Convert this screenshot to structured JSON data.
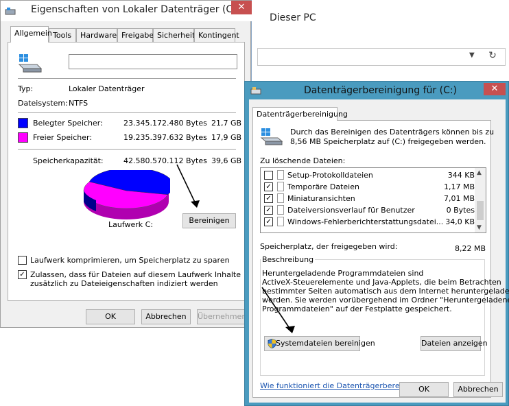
{
  "explorer": {
    "title": "Dieser PC",
    "dropdown_icon": "chevron-down-icon",
    "refresh_icon": "refresh-icon"
  },
  "properties": {
    "title": "Eigenschaften von Lokaler Datenträger (C:)",
    "close_icon": "close-icon",
    "tabs": [
      "Allgemein",
      "Tools",
      "Hardware",
      "Freigabe",
      "Sicherheit",
      "Kontingent"
    ],
    "name_value": "",
    "type_label": "Typ:",
    "type_value": "Lokaler Datenträger",
    "fs_label": "Dateisystem:",
    "fs_value": "NTFS",
    "used_label": "Belegter Speicher:",
    "used_bytes": "23.345.172.480 Bytes",
    "used_gb": "21,7 GB",
    "free_label": "Freier Speicher:",
    "free_bytes": "19.235.397.632 Bytes",
    "free_gb": "17,9 GB",
    "cap_label": "Speicherkapazität:",
    "cap_bytes": "42.580.570.112 Bytes",
    "cap_gb": "39,6 GB",
    "drive_label": "Laufwerk C:",
    "cleanup_button": "Bereinigen",
    "compress_label": "Laufwerk komprimieren, um Speicherplatz zu sparen",
    "compress_checked": false,
    "index_label_1": "Zulassen, dass für Dateien auf diesem Laufwerk Inhalte",
    "index_label_2": "zusätzlich zu Dateieigenschaften indiziert werden",
    "index_checked": true,
    "ok": "OK",
    "cancel": "Abbrechen",
    "apply": "Übernehmen",
    "used_color": "#0000ff",
    "free_color": "#ff00ff",
    "used_fraction": 0.548,
    "free_fraction": 0.452
  },
  "cleanup": {
    "title": "Datenträgerbereinigung für  (C:)",
    "close_icon": "close-icon",
    "tab": "Datenträgerbereinigung",
    "intro_1": "Durch das Bereinigen des Datenträgers können bis zu",
    "intro_2": "8,56 MB Speicherplatz auf  (C:) freigegeben werden.",
    "list_label": "Zu löschende Dateien:",
    "items": [
      {
        "label": "Setup-Protokolldateien",
        "size": "344 KB",
        "checked": false
      },
      {
        "label": "Temporäre Dateien",
        "size": "1,17 MB",
        "checked": true
      },
      {
        "label": "Miniaturansichten",
        "size": "7,01 MB",
        "checked": true
      },
      {
        "label": "Dateiversionsverlauf für Benutzer",
        "size": "0 Bytes",
        "checked": true
      },
      {
        "label": "Windows-Fehlerberichterstattungsdatei...",
        "size": "34,0 KB",
        "checked": true
      }
    ],
    "freed_label": "Speicherplatz, der freigegeben wird:",
    "freed_value": "8,22 MB",
    "desc_title": "Beschreibung",
    "desc_1": "Heruntergeladende Programmdateien sind",
    "desc_2": "ActiveX-Steuerelemente und Java-Applets, die beim Betrachten",
    "desc_3": "bestimmter Seiten automatisch aus dem Internet heruntergeladen",
    "desc_4": "werden. Sie werden vorübergehend im Ordner \"Heruntergeladene",
    "desc_5": "Programmdateien\" auf der Festplatte gespeichert.",
    "sys_button": "Systemdateien bereinigen",
    "view_button": "Dateien anzeigen",
    "help_link": "Wie funktioniert die Datenträgerbereinigung?",
    "ok": "OK",
    "cancel": "Abbrechen"
  }
}
